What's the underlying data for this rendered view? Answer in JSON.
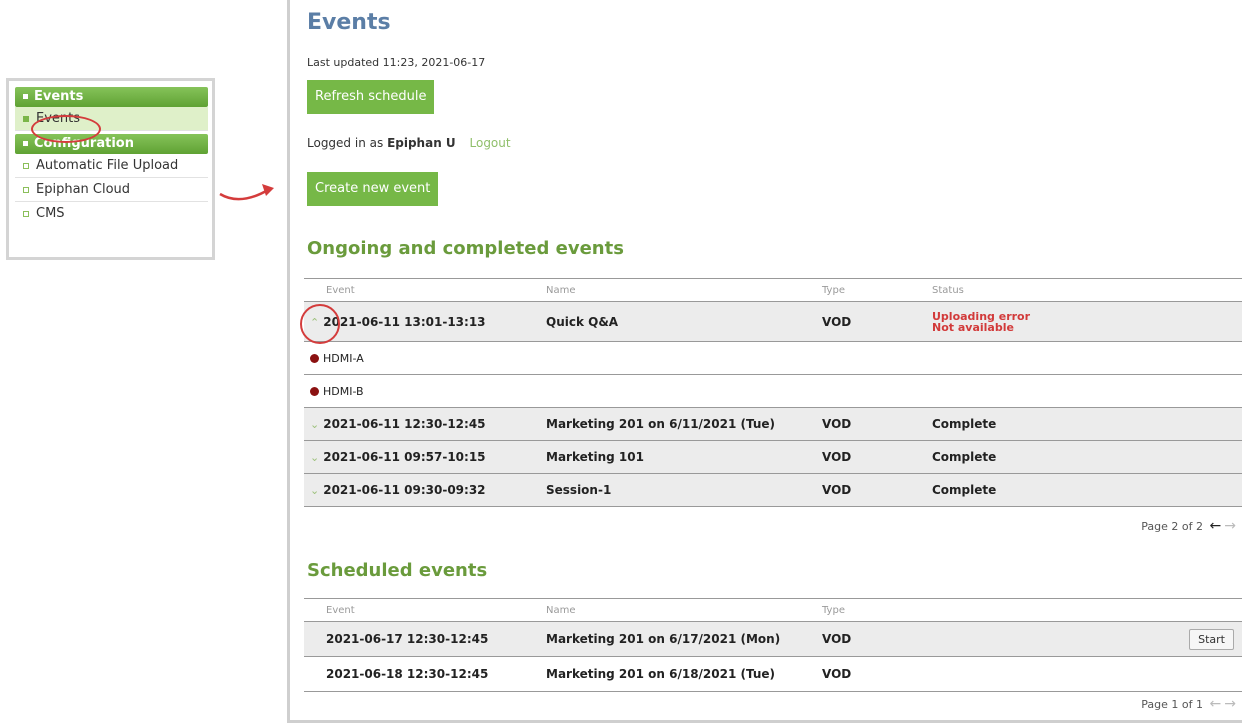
{
  "sidebar": {
    "section1": "Events",
    "section1_items": [
      "Events"
    ],
    "section2": "Configuration",
    "section2_items": [
      "Automatic File Upload",
      "Epiphan Cloud",
      "CMS"
    ]
  },
  "page": {
    "title": "Events",
    "last_updated": "Last updated 11:23, 2021-06-17",
    "refresh_label": "Refresh schedule",
    "logged_in_prefix": "Logged in as",
    "user": "Epiphan U",
    "logout_label": "Logout",
    "create_label": "Create new event"
  },
  "ongoing": {
    "title": "Ongoing and completed events",
    "headers": [
      "Event",
      "Name",
      "Type",
      "Status"
    ],
    "rows": [
      {
        "event": "2021-06-11 13:01-13:13",
        "name": "Quick Q&A",
        "type": "VOD",
        "status1": "Uploading error",
        "status2": "Not available"
      },
      {
        "event": "2021-06-11 12:30-12:45",
        "name": "Marketing 201 on 6/11/2021 (Tue)",
        "type": "VOD",
        "status": "Complete"
      },
      {
        "event": "2021-06-11 09:57-10:15",
        "name": "Marketing 101",
        "type": "VOD",
        "status": "Complete"
      },
      {
        "event": "2021-06-11 09:30-09:32",
        "name": "Session-1",
        "type": "VOD",
        "status": "Complete"
      }
    ],
    "sources": [
      "HDMI-A",
      "HDMI-B"
    ],
    "pager": "Page 2 of 2"
  },
  "scheduled": {
    "title": "Scheduled events",
    "headers": [
      "Event",
      "Name",
      "Type"
    ],
    "rows": [
      {
        "event": "2021-06-17 12:30-12:45",
        "name": "Marketing 201 on 6/17/2021 (Mon)",
        "type": "VOD"
      },
      {
        "event": "2021-06-18 12:30-12:45",
        "name": "Marketing 201 on 6/18/2021 (Tue)",
        "type": "VOD"
      }
    ],
    "start_label": "Start",
    "pager": "Page 1 of 1"
  },
  "icons": {
    "collapse": "chevron-up-icon",
    "expand": "chevron-down-icon",
    "prev": "arrow-left-icon",
    "next": "arrow-right-icon",
    "source": "recording-dot-icon"
  },
  "colors": {
    "accent_green": "#76b847",
    "title_blue": "#5b7ea6",
    "section_green": "#6a9b3c",
    "error_red": "#d23a3a",
    "annotation_red": "#d43c3c"
  }
}
